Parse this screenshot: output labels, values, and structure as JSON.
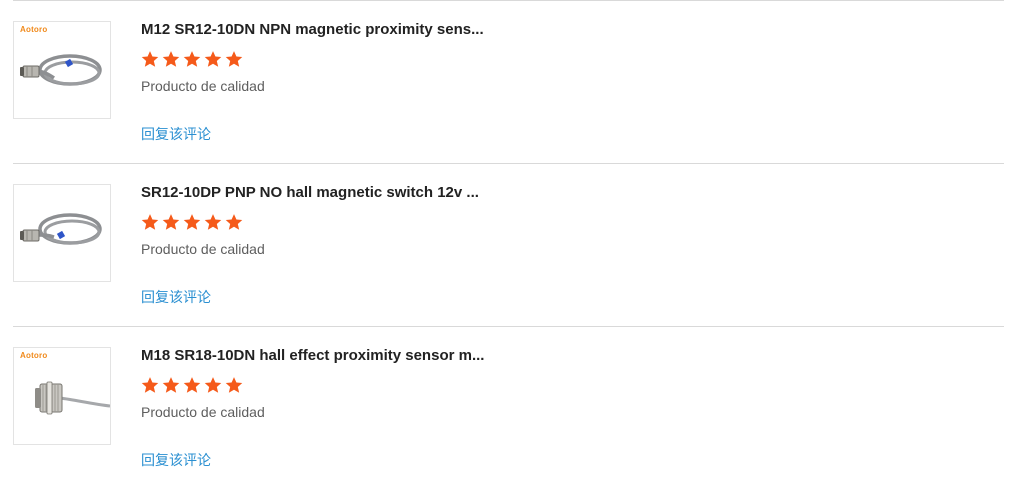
{
  "reviews": [
    {
      "brand": "Aotoro",
      "image_icon": "cable-proximity-sensor-image",
      "title": "M12 SR12-10DN NPN magnetic proximity sens...",
      "rating": 5,
      "rating_max": 5,
      "comment": "Producto de calidad",
      "reply_label": "回复该评论"
    },
    {
      "brand": "",
      "image_icon": "cable-proximity-sensor-image",
      "title": "SR12-10DP PNP NO hall magnetic switch 12v ...",
      "rating": 5,
      "rating_max": 5,
      "comment": "Producto de calidad",
      "reply_label": "回复该评论"
    },
    {
      "brand": "Aotoro",
      "image_icon": "threaded-barrel-sensor-image",
      "title": "M18 SR18-10DN hall effect proximity sensor m...",
      "rating": 5,
      "rating_max": 5,
      "comment": "Producto de calidad",
      "reply_label": "回复该评论"
    }
  ],
  "colors": {
    "star": "#f55a1a",
    "reply_link": "#2a8fd1",
    "brand": "#f08a1c",
    "title": "#222222",
    "divider": "#d9d9d9"
  }
}
